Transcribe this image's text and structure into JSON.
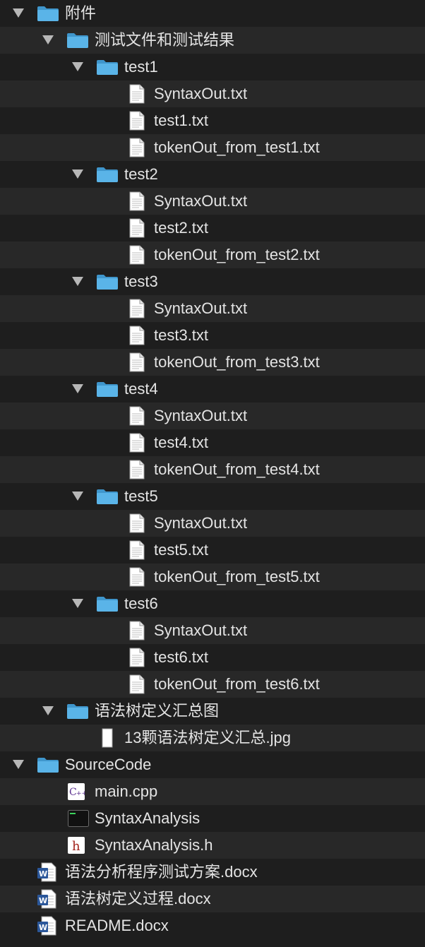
{
  "rows": [
    {
      "label": "附件",
      "depth": 0,
      "type": "folder",
      "expanded": true,
      "name": "folder-fujian"
    },
    {
      "label": "测试文件和测试结果",
      "depth": 1,
      "type": "folder",
      "expanded": true,
      "name": "folder-test-files-and-results"
    },
    {
      "label": "test1",
      "depth": 2,
      "type": "folder",
      "expanded": true,
      "name": "folder-test1"
    },
    {
      "label": "SyntaxOut.txt",
      "depth": 3,
      "type": "txt",
      "name": "file-test1-syntaxout"
    },
    {
      "label": "test1.txt",
      "depth": 3,
      "type": "txt",
      "name": "file-test1-txt"
    },
    {
      "label": "tokenOut_from_test1.txt",
      "depth": 3,
      "type": "txt",
      "name": "file-test1-tokenout"
    },
    {
      "label": "test2",
      "depth": 2,
      "type": "folder",
      "expanded": true,
      "name": "folder-test2"
    },
    {
      "label": "SyntaxOut.txt",
      "depth": 3,
      "type": "txt",
      "name": "file-test2-syntaxout"
    },
    {
      "label": "test2.txt",
      "depth": 3,
      "type": "txt",
      "name": "file-test2-txt"
    },
    {
      "label": "tokenOut_from_test2.txt",
      "depth": 3,
      "type": "txt",
      "name": "file-test2-tokenout"
    },
    {
      "label": "test3",
      "depth": 2,
      "type": "folder",
      "expanded": true,
      "name": "folder-test3"
    },
    {
      "label": "SyntaxOut.txt",
      "depth": 3,
      "type": "txt",
      "name": "file-test3-syntaxout"
    },
    {
      "label": "test3.txt",
      "depth": 3,
      "type": "txt",
      "name": "file-test3-txt"
    },
    {
      "label": "tokenOut_from_test3.txt",
      "depth": 3,
      "type": "txt",
      "name": "file-test3-tokenout"
    },
    {
      "label": "test4",
      "depth": 2,
      "type": "folder",
      "expanded": true,
      "name": "folder-test4"
    },
    {
      "label": "SyntaxOut.txt",
      "depth": 3,
      "type": "txt",
      "name": "file-test4-syntaxout"
    },
    {
      "label": "test4.txt",
      "depth": 3,
      "type": "txt",
      "name": "file-test4-txt"
    },
    {
      "label": "tokenOut_from_test4.txt",
      "depth": 3,
      "type": "txt",
      "name": "file-test4-tokenout"
    },
    {
      "label": "test5",
      "depth": 2,
      "type": "folder",
      "expanded": true,
      "name": "folder-test5"
    },
    {
      "label": "SyntaxOut.txt",
      "depth": 3,
      "type": "txt",
      "name": "file-test5-syntaxout"
    },
    {
      "label": "test5.txt",
      "depth": 3,
      "type": "txt",
      "name": "file-test5-txt"
    },
    {
      "label": "tokenOut_from_test5.txt",
      "depth": 3,
      "type": "txt",
      "name": "file-test5-tokenout"
    },
    {
      "label": "test6",
      "depth": 2,
      "type": "folder",
      "expanded": true,
      "name": "folder-test6"
    },
    {
      "label": "SyntaxOut.txt",
      "depth": 3,
      "type": "txt",
      "name": "file-test6-syntaxout"
    },
    {
      "label": "test6.txt",
      "depth": 3,
      "type": "txt",
      "name": "file-test6-txt"
    },
    {
      "label": "tokenOut_from_test6.txt",
      "depth": 3,
      "type": "txt",
      "name": "file-test6-tokenout"
    },
    {
      "label": "语法树定义汇总图",
      "depth": 1,
      "type": "folder",
      "expanded": true,
      "name": "folder-syntax-tree-summary"
    },
    {
      "label": "13颗语法树定义汇总.jpg",
      "depth": 2,
      "type": "jpg",
      "name": "file-syntax-tree-summary-jpg"
    },
    {
      "label": "SourceCode",
      "depth": 0,
      "type": "folder",
      "expanded": true,
      "name": "folder-sourcecode"
    },
    {
      "label": "main.cpp",
      "depth": 1,
      "type": "cpp",
      "name": "file-main-cpp"
    },
    {
      "label": "SyntaxAnalysis",
      "depth": 1,
      "type": "exec",
      "name": "file-syntaxanalysis-exec"
    },
    {
      "label": "SyntaxAnalysis.h",
      "depth": 1,
      "type": "h",
      "name": "file-syntaxanalysis-h"
    },
    {
      "label": "语法分析程序测试方案.docx",
      "depth": 0,
      "type": "docx",
      "name": "file-test-plan-docx"
    },
    {
      "label": "语法树定义过程.docx",
      "depth": 0,
      "type": "docx",
      "name": "file-syntax-tree-process-docx"
    },
    {
      "label": "README.docx",
      "depth": 0,
      "type": "docx",
      "name": "file-readme-docx"
    }
  ],
  "icons": {
    "folder": "folder-icon",
    "txt": "text-file-icon",
    "jpg": "image-file-icon",
    "cpp": "cpp-file-icon",
    "exec": "executable-icon",
    "h": "header-file-icon",
    "docx": "word-document-icon"
  },
  "colors": {
    "background": "#1e1e1e",
    "stripe": "#282828",
    "text": "#e4e4e4",
    "disclosure": "#b7b7b7",
    "folder": "#5ab4e8",
    "folder_dark": "#3f96cc",
    "word": "#2b579a"
  }
}
